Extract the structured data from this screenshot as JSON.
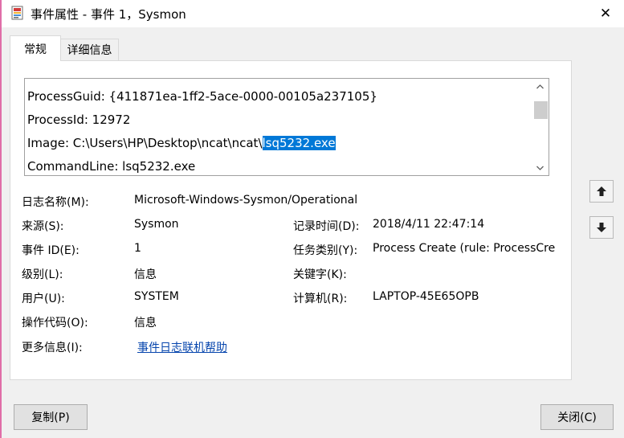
{
  "window": {
    "title": "事件属性 - 事件 1，Sysmon",
    "close_glyph": "✕"
  },
  "tabs": {
    "general": "常规",
    "details": "详细信息"
  },
  "description": {
    "lines": [
      "ProcessGuid: {411871ea-1ff2-5ace-0000-00105a237105}",
      "ProcessId: 12972",
      "Image: C:\\Users\\HP\\Desktop\\ncat\\ncat\\",
      "CommandLine: lsq5232.exe"
    ],
    "image_selected": "lsq5232.exe"
  },
  "fields": {
    "log_name": {
      "label": "日志名称(M):",
      "value": "Microsoft-Windows-Sysmon/Operational"
    },
    "source": {
      "label": "来源(S):",
      "value": "Sysmon"
    },
    "logged": {
      "label": "记录时间(D):",
      "value": "2018/4/11 22:47:14"
    },
    "event_id": {
      "label": "事件 ID(E):",
      "value": "1"
    },
    "task_category": {
      "label": "任务类别(Y):",
      "value": "Process Create (rule: ProcessCreat"
    },
    "level": {
      "label": "级别(L):",
      "value": "信息"
    },
    "keywords": {
      "label": "关键字(K):",
      "value": ""
    },
    "user": {
      "label": "用户(U):",
      "value": "SYSTEM"
    },
    "computer": {
      "label": "计算机(R):",
      "value": "LAPTOP-45E65OPB"
    },
    "opcode": {
      "label": "操作代码(O):",
      "value": "信息"
    },
    "more_info": {
      "label": "更多信息(I):",
      "link": "事件日志联机帮助"
    }
  },
  "buttons": {
    "copy": "复制(P)",
    "close": "关闭(C)"
  },
  "colors": {
    "selection": "#0078d7",
    "link": "#0645ad",
    "window_accent": "#e06ea8"
  },
  "icons": {
    "app": "event-viewer-icon",
    "up": "arrow-up-icon",
    "down": "arrow-down-icon"
  }
}
